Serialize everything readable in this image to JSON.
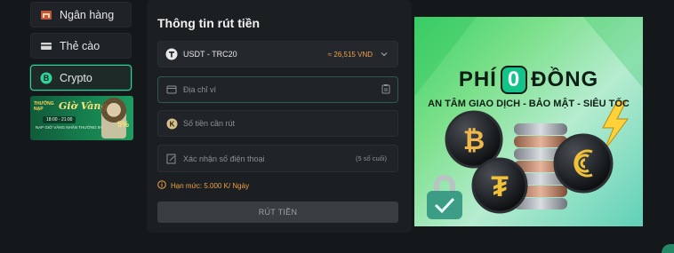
{
  "sidebar": {
    "items": [
      {
        "label": "Ngân hàng",
        "icon": "bank-icon"
      },
      {
        "label": "Thẻ cào",
        "icon": "card-icon"
      },
      {
        "label": "Crypto",
        "icon": "bitcoin-icon",
        "active": true
      }
    ],
    "promo": {
      "line1": "THƯỞNG",
      "line2": "NẠP",
      "script": "Giờ Vàng",
      "time": "18:00 - 21:00",
      "bottom": "NẠP GIỜ VÀNG NHẬN THƯỞNG 5%",
      "percent": "5%"
    }
  },
  "form": {
    "title": "Thông tin rút tiền",
    "currency": {
      "value": "USDT - TRC20",
      "rate": "≈ 26,515 VND"
    },
    "address_placeholder": "Địa chỉ ví",
    "amount_placeholder": "Số tiền cần rút",
    "phone_placeholder": "Xác nhận số điện thoại",
    "phone_hint": "(5 số cuối)",
    "limit": "Hạn mức: 5.000 K/ Ngày",
    "submit_label": "RÚT TIỀN"
  },
  "banner": {
    "word1": "PHÍ",
    "zero": "0",
    "word2": "ĐỒNG",
    "tagline": "AN TÂM GIAO DỊCH - BẢO MẬT - SIÊU TỐC"
  },
  "colors": {
    "accent": "#2fd39b",
    "warning": "#f0a24a",
    "background": "#15181b"
  }
}
